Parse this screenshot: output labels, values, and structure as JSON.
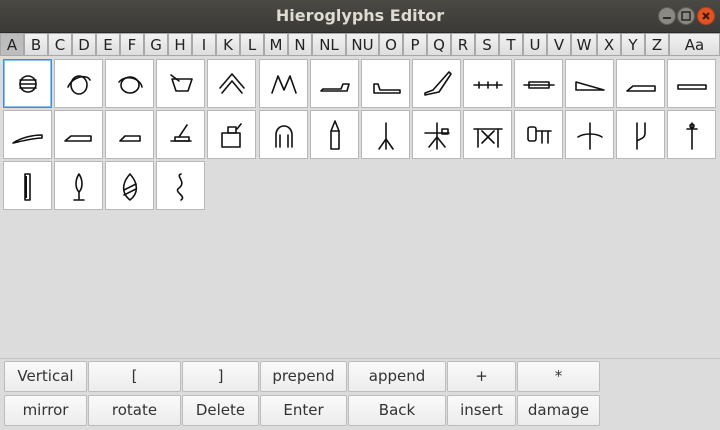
{
  "window": {
    "title": "Hieroglyphs Editor"
  },
  "letter_tabs": [
    "A",
    "B",
    "C",
    "D",
    "E",
    "F",
    "G",
    "H",
    "I",
    "K",
    "L",
    "M",
    "N",
    "NL",
    "NU",
    "O",
    "P",
    "Q",
    "R",
    "S",
    "T",
    "U",
    "V",
    "W",
    "X",
    "Y",
    "Z",
    "Aa"
  ],
  "active_tab": "A",
  "glyphs": {
    "count": 32,
    "selected_index": 0
  },
  "buttons": {
    "row1": [
      "Vertical",
      "[",
      "]",
      "prepend",
      "append",
      "+",
      "*"
    ],
    "row2": [
      "mirror",
      "rotate",
      "Delete",
      "Enter",
      "Back",
      "insert",
      "damage"
    ]
  }
}
